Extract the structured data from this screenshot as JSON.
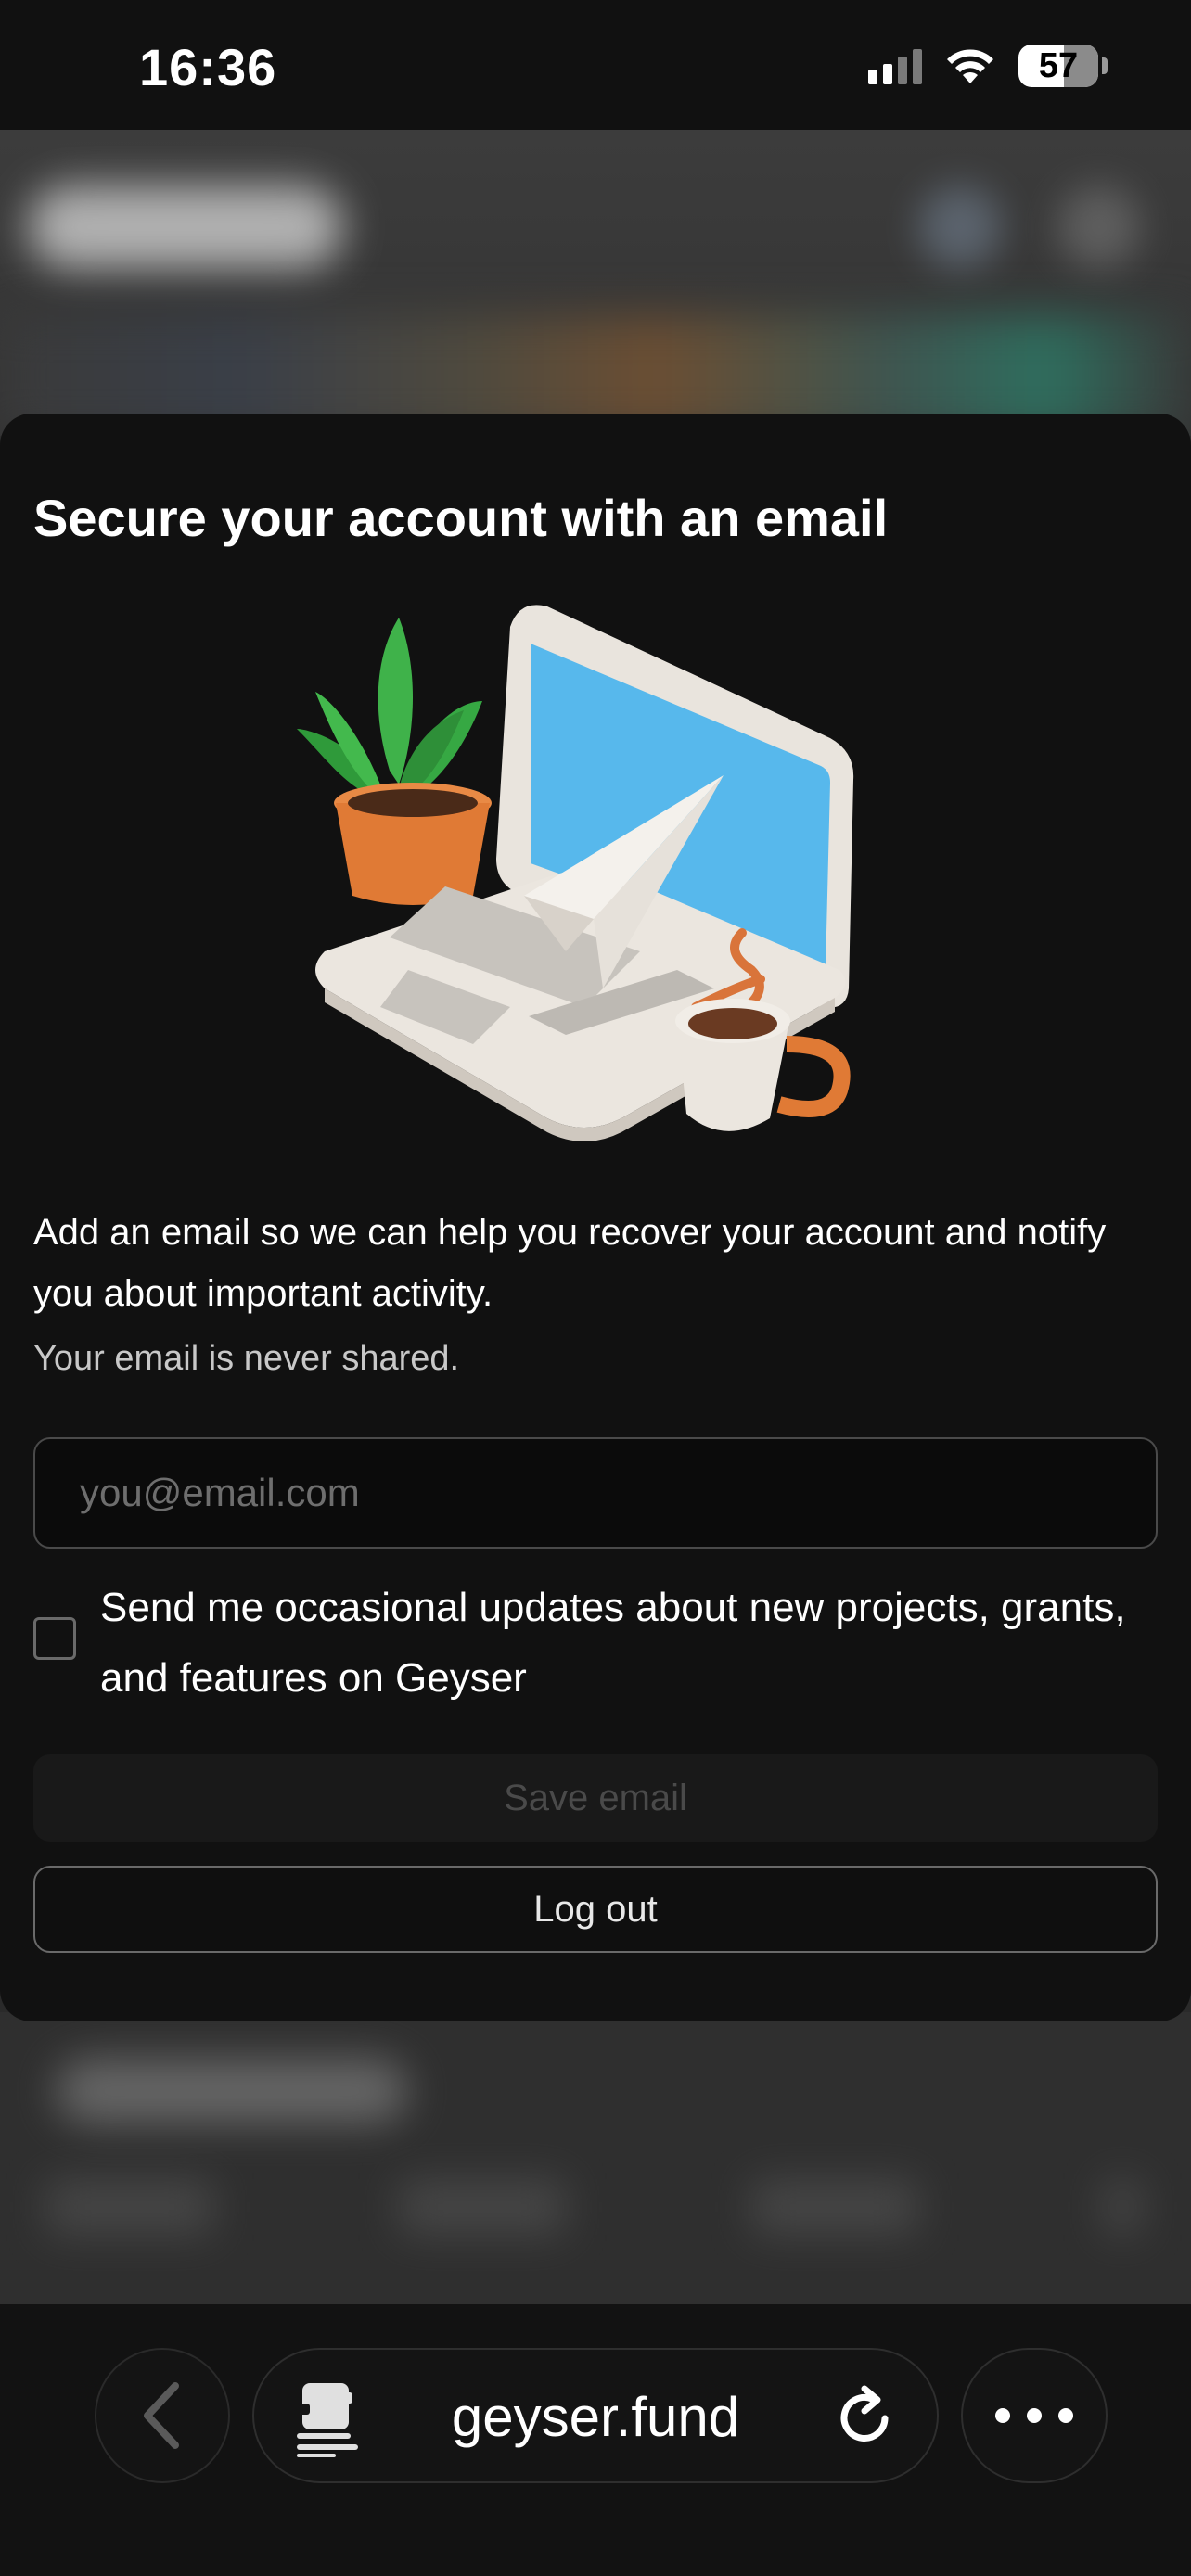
{
  "status_bar": {
    "time": "16:36",
    "battery_level": "57",
    "icons": [
      "signal-icon",
      "wifi-icon",
      "battery-icon"
    ]
  },
  "modal": {
    "title": "Secure your account with an email",
    "description": "Add an email so we can help you recover your account and notify you about important activity.",
    "note": "Your email is never shared.",
    "email_input": {
      "value": "",
      "placeholder": "you@email.com"
    },
    "updates_checkbox": {
      "checked": false,
      "label": "Send me occasional updates about new projects, grants, and features on Geyser"
    },
    "save_label": "Save email",
    "logout_label": "Log out"
  },
  "browser": {
    "url": "geyser.fund",
    "icons": [
      "back-arrow-icon",
      "reader-icon",
      "reload-icon",
      "more-icon"
    ]
  },
  "colors": {
    "background": "#111111",
    "sheet": "#111111",
    "input_border": "#4a4a4a",
    "disabled_text": "#4a4a4a"
  }
}
